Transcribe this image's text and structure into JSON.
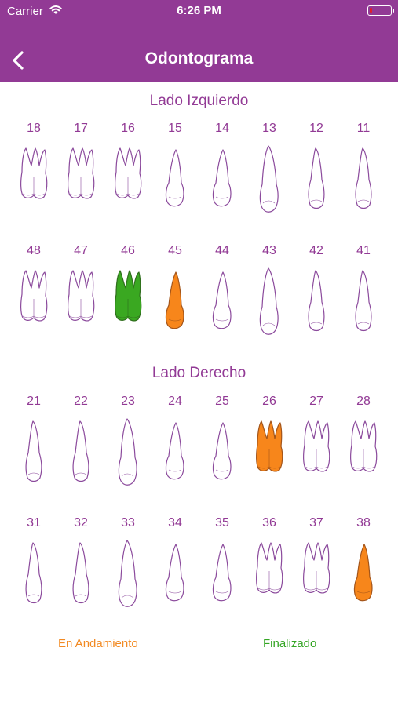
{
  "status_bar": {
    "carrier": "Carrier",
    "time": "6:26 PM"
  },
  "header": {
    "title": "Odontograma"
  },
  "sections": {
    "left": "Lado Izquierdo",
    "right": "Lado Derecho"
  },
  "rows": [
    {
      "teeth": [
        {
          "number": "18",
          "type": "molar",
          "status": "none"
        },
        {
          "number": "17",
          "type": "molar",
          "status": "none"
        },
        {
          "number": "16",
          "type": "molar",
          "status": "none"
        },
        {
          "number": "15",
          "type": "premolar",
          "status": "none"
        },
        {
          "number": "14",
          "type": "premolar",
          "status": "none"
        },
        {
          "number": "13",
          "type": "canine",
          "status": "none"
        },
        {
          "number": "12",
          "type": "incisor",
          "status": "none"
        },
        {
          "number": "11",
          "type": "incisor",
          "status": "none"
        }
      ]
    },
    {
      "teeth": [
        {
          "number": "48",
          "type": "molar",
          "status": "none"
        },
        {
          "number": "47",
          "type": "molar",
          "status": "none"
        },
        {
          "number": "46",
          "type": "molar",
          "status": "finalizado"
        },
        {
          "number": "45",
          "type": "premolar",
          "status": "andamiento"
        },
        {
          "number": "44",
          "type": "premolar",
          "status": "none"
        },
        {
          "number": "43",
          "type": "canine",
          "status": "none"
        },
        {
          "number": "42",
          "type": "incisor",
          "status": "none"
        },
        {
          "number": "41",
          "type": "incisor",
          "status": "none"
        }
      ]
    },
    {
      "teeth": [
        {
          "number": "21",
          "type": "incisor",
          "status": "none"
        },
        {
          "number": "22",
          "type": "incisor",
          "status": "none"
        },
        {
          "number": "23",
          "type": "canine",
          "status": "none"
        },
        {
          "number": "24",
          "type": "premolar",
          "status": "none"
        },
        {
          "number": "25",
          "type": "premolar",
          "status": "none"
        },
        {
          "number": "26",
          "type": "molar",
          "status": "andamiento"
        },
        {
          "number": "27",
          "type": "molar",
          "status": "none"
        },
        {
          "number": "28",
          "type": "molar",
          "status": "none"
        }
      ]
    },
    {
      "teeth": [
        {
          "number": "31",
          "type": "incisor",
          "status": "none"
        },
        {
          "number": "32",
          "type": "incisor",
          "status": "none"
        },
        {
          "number": "33",
          "type": "canine",
          "status": "none"
        },
        {
          "number": "34",
          "type": "premolar",
          "status": "none"
        },
        {
          "number": "35",
          "type": "premolar",
          "status": "none"
        },
        {
          "number": "36",
          "type": "molar",
          "status": "none"
        },
        {
          "number": "37",
          "type": "molar",
          "status": "none"
        },
        {
          "number": "38",
          "type": "premolar",
          "status": "andamiento"
        }
      ]
    }
  ],
  "legend": {
    "in_progress": "En Andamiento",
    "finished": "Finalizado"
  },
  "colors": {
    "header": "#923a95",
    "outline": "#8b4a9c",
    "andamiento": "#f7861b",
    "finalizado": "#3aa821",
    "legend_progress": "#f28a23",
    "legend_done": "#34a524"
  },
  "icons": {
    "back": "chevron-left-icon",
    "wifi": "wifi-icon",
    "battery": "battery-icon"
  }
}
